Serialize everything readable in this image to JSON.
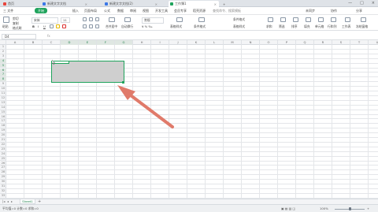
{
  "tabs": [
    {
      "label": "首页",
      "color": "#e8453c"
    },
    {
      "label": "新建文字文档",
      "color": "#3b78e7"
    },
    {
      "label": "新建文字文档(2)",
      "color": "#3b78e7"
    },
    {
      "label": "工作簿1",
      "color": "#1fa35c",
      "active": true
    }
  ],
  "menu": [
    "三 文件",
    "开始",
    "插入",
    "页面布局",
    "公式",
    "数据",
    "审阅",
    "视图",
    "开发工具",
    "会员专享",
    "稻壳资源",
    "查找命令、搜索模板"
  ],
  "menu_right": [
    "未同步",
    "协作",
    "分享"
  ],
  "ribbon": {
    "paste": "粘贴",
    "cut": "剪切",
    "copy": "复制",
    "format_painter": "格式刷",
    "font_name": "宋体",
    "font_size": "11",
    "bold": "B",
    "italic": "I",
    "underline": "U",
    "merge": "合并居中",
    "wrap": "自动换行",
    "number_format": "常规",
    "cond_format": "条件格式",
    "table_style": "表格样式",
    "sum": "求和",
    "filter": "筛选",
    "sort": "排序",
    "fill": "填充",
    "cell": "单元格",
    "row_col": "行和列",
    "sheet": "工作表",
    "freeze": "冻结窗格"
  },
  "formula_bar": {
    "name_box": "D4",
    "fx": "fx"
  },
  "columns": [
    "A",
    "B",
    "C",
    "D",
    "E",
    "F",
    "G",
    "H",
    "I",
    "J",
    "K",
    "L",
    "M",
    "N",
    "O",
    "P",
    "Q",
    "R",
    "S",
    "T",
    "U"
  ],
  "rows": [
    "1",
    "2",
    "3",
    "4",
    "5",
    "6",
    "7",
    "8",
    "9",
    "10",
    "11",
    "12",
    "13",
    "14",
    "15",
    "16",
    "17",
    "18",
    "19",
    "20",
    "21",
    "22",
    "23",
    "24",
    "25",
    "26",
    "27",
    "28",
    "29",
    "30",
    "31",
    "32",
    "33"
  ],
  "selection": {
    "range": "D4:G8",
    "columns": [
      "D",
      "E",
      "F",
      "G"
    ],
    "rows": [
      "4",
      "5",
      "6",
      "7",
      "8"
    ]
  },
  "sheet_tab": "Sheet1",
  "status": {
    "left": "平均值=0  计数=0  求和=0",
    "zoom": "100%"
  },
  "colors": {
    "accent": "#1fa35c",
    "selection_fill": "#cfcfcf",
    "arrow": "#e07a6a"
  }
}
